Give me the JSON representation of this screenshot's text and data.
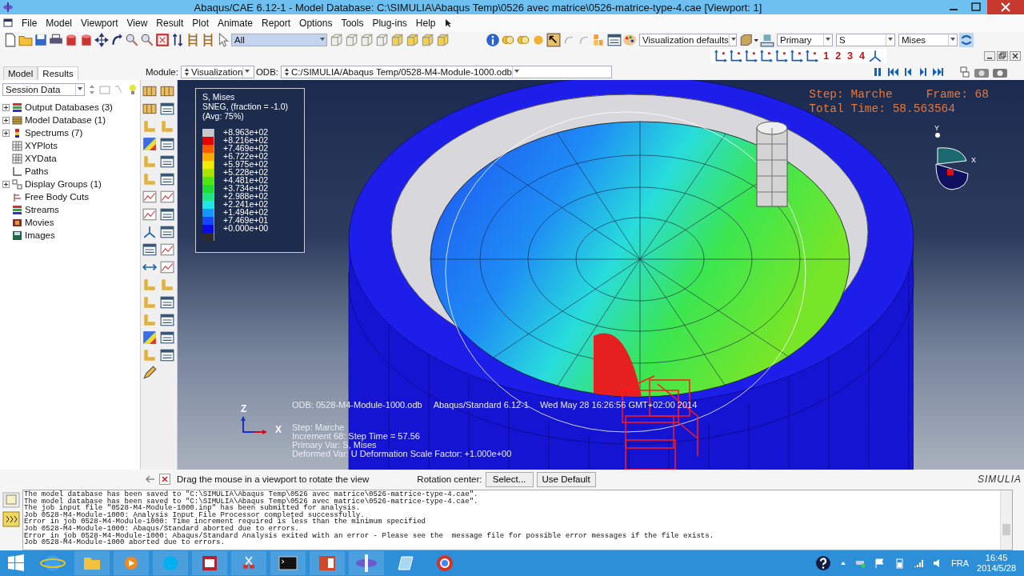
{
  "window": {
    "title": "Abaqus/CAE 6.12-1 - Model Database: C:\\SIMULIA\\Abaqus Temp\\0526 avec matrice\\0526-matrice-type-4.cae [Viewport: 1]"
  },
  "menu": [
    "File",
    "Model",
    "Viewport",
    "View",
    "Result",
    "Plot",
    "Animate",
    "Report",
    "Options",
    "Tools",
    "Plug-ins",
    "Help"
  ],
  "toolbar": {
    "selection_filter": "All",
    "view_set": "Visualization defaults",
    "step_output": "Primary",
    "variable": "S",
    "invariant": "Mises",
    "view_numbers": [
      "1",
      "2",
      "3",
      "4"
    ]
  },
  "model_tree": {
    "tabs": [
      {
        "label": "Model",
        "selected": false
      },
      {
        "label": "Results",
        "selected": true
      }
    ],
    "filter": "Session Data",
    "items": [
      {
        "label": "Output Databases (3)",
        "kind": "group",
        "expanded": false
      },
      {
        "label": "Model Database (1)",
        "kind": "group",
        "expanded": false
      },
      {
        "label": "Spectrums (7)",
        "kind": "group",
        "expanded": false
      },
      {
        "label": "XYPlots",
        "kind": "leaf"
      },
      {
        "label": "XYData",
        "kind": "leaf"
      },
      {
        "label": "Paths",
        "kind": "leaf"
      },
      {
        "label": "Display Groups (1)",
        "kind": "group",
        "expanded": false
      },
      {
        "label": "Free Body Cuts",
        "kind": "leaf"
      },
      {
        "label": "Streams",
        "kind": "leaf"
      },
      {
        "label": "Movies",
        "kind": "leaf"
      },
      {
        "label": "Images",
        "kind": "leaf"
      }
    ]
  },
  "context": {
    "module_label": "Module:",
    "module": "Visualization",
    "odb_label": "ODB:",
    "odb": "C:/SIMULIA/Abaqus Temp/0528-M4-Module-1000.odb"
  },
  "viewport": {
    "legend": {
      "title_lines": [
        "S, Mises",
        "SNEG, (fraction = -1.0)",
        "(Avg: 75%)"
      ],
      "entries": [
        {
          "label": "+8.963e+02",
          "color": "#c8c8c8"
        },
        {
          "label": "+8.216e+02",
          "color": "#e60000"
        },
        {
          "label": "+7.469e+02",
          "color": "#ff5a00"
        },
        {
          "label": "+6.722e+02",
          "color": "#ffaa00"
        },
        {
          "label": "+5.975e+02",
          "color": "#f0eb00"
        },
        {
          "label": "+5.228e+02",
          "color": "#a8e600"
        },
        {
          "label": "+4.481e+02",
          "color": "#50e614"
        },
        {
          "label": "+3.734e+02",
          "color": "#1edc32"
        },
        {
          "label": "+2.988e+02",
          "color": "#1ee682"
        },
        {
          "label": "+2.241e+02",
          "color": "#1ee6e6"
        },
        {
          "label": "+1.494e+02",
          "color": "#1496ff"
        },
        {
          "label": "+7.469e+01",
          "color": "#1446ff"
        },
        {
          "label": "+0.000e+00",
          "color": "#0a0ae6"
        },
        {
          "color": "#2b2b2b"
        }
      ]
    },
    "step_info": {
      "step": "Step: Marche",
      "frame": "Frame: 68",
      "total_time": "Total Time: 58.563564"
    },
    "view_triad": [
      "Y",
      "X"
    ],
    "odb_line": [
      "ODB: 0528-M4-Module-1000.odb",
      "Abaqus/Standard 6.12-1",
      "Wed May 28 16:26:56 GMT+02:00 2014"
    ],
    "state_lines": [
      "Step: Marche",
      "Increment     68: Step Time =    57.56",
      "Primary Var: S, Mises",
      "Deformed Var: U   Deformation Scale Factor: +1.000e+00"
    ],
    "axis_labels": [
      "Z",
      "X"
    ]
  },
  "prompt": {
    "text": "Drag the mouse in a viewport to rotate the view",
    "rotation_label": "Rotation center:",
    "select": "Select...",
    "use_default": "Use Default",
    "brand": "SIMULIA"
  },
  "messages": [
    "The model database has been saved to \"C:\\SIMULIA\\Abaqus Temp\\0526 avec matrice\\0526-matrice-type-4.cae\".",
    "The model database has been saved to \"C:\\SIMULIA\\Abaqus Temp\\0526 avec matrice\\0526-matrice-type-4.cae\".",
    "The job input file \"0528-M4-Module-1000.inp\" has been submitted for analysis.",
    "Job 0528-M4-Module-1000: Analysis Input File Processor completed successfully.",
    "Error in job 0528-M4-Module-1000: Time increment required is less than the minimum specified",
    "Job 0528-M4-Module-1000: Abaqus/Standard aborted due to errors.",
    "Error in job 0528-M4-Module-1000: Abaqus/Standard Analysis exited with an error - Please see the  message file for possible error messages if the file exists.",
    "Job 0528-M4-Module-1000 aborted due to errors."
  ],
  "taskbar": {
    "language": "FRA",
    "time": "16:45",
    "date": "2014/5/28"
  }
}
